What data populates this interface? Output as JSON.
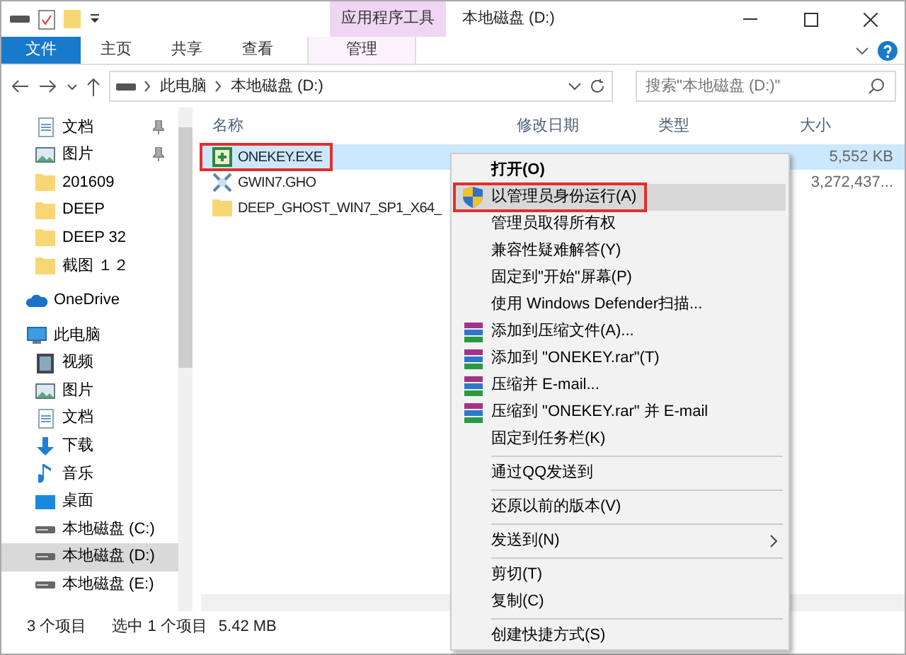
{
  "window": {
    "title": "本地磁盘 (D:)",
    "context_tab_group": "应用程序工具"
  },
  "ribbon_tabs": [
    {
      "label": "文件",
      "kind": "file",
      "selected": false
    },
    {
      "label": "主页",
      "kind": "tab",
      "selected": false
    },
    {
      "label": "共享",
      "kind": "tab",
      "selected": false
    },
    {
      "label": "查看",
      "kind": "tab",
      "selected": false
    },
    {
      "label": "管理",
      "kind": "context",
      "selected": false
    }
  ],
  "address": {
    "path": [
      "此电脑",
      "本地磁盘 (D:)"
    ]
  },
  "search": {
    "placeholder": "搜索\"本地磁盘 (D:)\""
  },
  "sidebar": {
    "items": [
      {
        "label": "文档",
        "kind": "document",
        "pinned": true,
        "selected": false
      },
      {
        "label": "图片",
        "kind": "picture",
        "pinned": true,
        "selected": false
      },
      {
        "label": "201609",
        "kind": "folder",
        "pinned": false,
        "selected": false
      },
      {
        "label": "DEEP",
        "kind": "folder",
        "pinned": false,
        "selected": false
      },
      {
        "label": "DEEP 32",
        "kind": "folder",
        "pinned": false,
        "selected": false
      },
      {
        "label": "截图 １２",
        "kind": "folder",
        "pinned": false,
        "selected": false
      },
      {
        "label": "OneDrive",
        "kind": "cloud",
        "pinned": false,
        "selected": false
      },
      {
        "label": "此电脑",
        "kind": "computer",
        "pinned": false,
        "selected": false
      },
      {
        "label": "视频",
        "kind": "video",
        "pinned": false,
        "selected": false
      },
      {
        "label": "图片",
        "kind": "picture",
        "pinned": false,
        "selected": false
      },
      {
        "label": "文档",
        "kind": "document",
        "pinned": false,
        "selected": false
      },
      {
        "label": "下载",
        "kind": "download",
        "pinned": false,
        "selected": false
      },
      {
        "label": "音乐",
        "kind": "music",
        "pinned": false,
        "selected": false
      },
      {
        "label": "桌面",
        "kind": "desktop",
        "pinned": false,
        "selected": false
      },
      {
        "label": "本地磁盘 (C:)",
        "kind": "drive",
        "pinned": false,
        "selected": false
      },
      {
        "label": "本地磁盘 (D:)",
        "kind": "drive",
        "pinned": false,
        "selected": true
      },
      {
        "label": "本地磁盘 (E:)",
        "kind": "drive",
        "pinned": false,
        "selected": false
      }
    ]
  },
  "file_list": {
    "columns": [
      "名称",
      "修改日期",
      "类型",
      "大小"
    ],
    "rows": [
      {
        "name": "ONEKEY.EXE",
        "kind": "exe",
        "size": "5,552 KB",
        "selected": true,
        "annotated": true
      },
      {
        "name": "GWIN7.GHO",
        "kind": "gho",
        "size": "3,272,437...",
        "selected": false,
        "annotated": false
      },
      {
        "name": "DEEP_GHOST_WIN7_SP1_X64_",
        "kind": "folder",
        "selected": false,
        "annotated": false
      }
    ]
  },
  "context_menu": {
    "groups": [
      [
        {
          "label": "打开(O)",
          "kind": "plain",
          "default": true,
          "selected": false,
          "annotated": false
        },
        {
          "label": "以管理员身份运行(A)",
          "kind": "shield",
          "selected": true,
          "annotated": true
        },
        {
          "label": "管理员取得所有权",
          "kind": "plain",
          "selected": false,
          "annotated": false
        },
        {
          "label": "兼容性疑难解答(Y)",
          "kind": "plain",
          "selected": false,
          "annotated": false
        },
        {
          "label": "固定到\"开始\"屏幕(P)",
          "kind": "plain",
          "selected": false,
          "annotated": false
        },
        {
          "label": "使用 Windows Defender扫描...",
          "kind": "plain",
          "selected": false,
          "annotated": false
        },
        {
          "label": "添加到压缩文件(A)...",
          "kind": "archive",
          "selected": false,
          "annotated": false
        },
        {
          "label": "添加到 \"ONEKEY.rar\"(T)",
          "kind": "archive",
          "selected": false,
          "annotated": false
        },
        {
          "label": "压缩并 E-mail...",
          "kind": "archive",
          "selected": false,
          "annotated": false
        },
        {
          "label": "压缩到 \"ONEKEY.rar\" 并 E-mail",
          "kind": "archive",
          "selected": false,
          "annotated": false
        },
        {
          "label": "固定到任务栏(K)",
          "kind": "plain",
          "selected": false,
          "annotated": false
        }
      ],
      [
        {
          "label": "通过QQ发送到",
          "kind": "plain",
          "selected": false,
          "annotated": false
        }
      ],
      [
        {
          "label": "还原以前的版本(V)",
          "kind": "plain",
          "selected": false,
          "annotated": false
        }
      ],
      [
        {
          "label": "发送到(N)",
          "kind": "submenu",
          "selected": false,
          "annotated": false
        }
      ],
      [
        {
          "label": "剪切(T)",
          "kind": "plain",
          "selected": false,
          "annotated": false
        },
        {
          "label": "复制(C)",
          "kind": "plain",
          "selected": false,
          "annotated": false
        }
      ],
      [
        {
          "label": "创建快捷方式(S)",
          "kind": "plain",
          "selected": false,
          "annotated": false
        }
      ]
    ]
  },
  "status_bar": {
    "items": [
      "3 个项目",
      "选中 1 个项目",
      "5.42 MB"
    ]
  }
}
